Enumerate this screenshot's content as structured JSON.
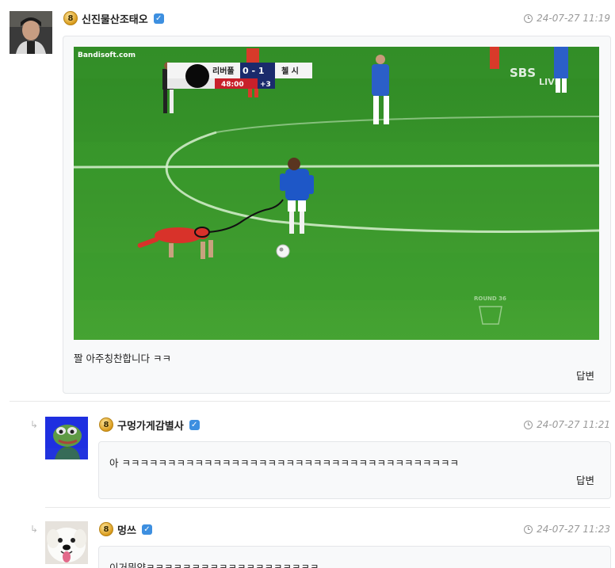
{
  "comments": [
    {
      "username": "신진물산조태오",
      "level": "8",
      "timestamp": "24-07-27 11:19",
      "text": "짤 아주칭찬합니다 ㅋㅋ",
      "reply_label": "답변",
      "media": {
        "watermark": "Bandisoft.com",
        "broadcaster": "SBS",
        "live": "LIVE",
        "score_team_home": "리버풀",
        "score": "0 - 1",
        "score_team_away": "첼 시",
        "match_clock": "48:00",
        "added_time": "+3",
        "round": "ROUND 36"
      }
    },
    {
      "username": "구멍가게감별사",
      "level": "8",
      "timestamp": "24-07-27 11:21",
      "text": "아 ㅋㅋㅋㅋㅋㅋㅋㅋㅋㅋㅋㅋㅋㅋㅋㅋㅋㅋㅋㅋㅋㅋㅋㅋㅋㅋㅋㅋㅋㅋㅋㅋㅋㅋㅋㅋㅋ",
      "reply_label": "답변"
    },
    {
      "username": "멍쓰",
      "level": "8",
      "timestamp": "24-07-27 11:23",
      "text": "이거뭐얌ㅋㅋㅋㅋㅋㅋㅋㅋㅋㅋㅋㅋㅋㅋㅋㅋㅋㅋㅋ"
    }
  ],
  "colors": {
    "pitch": "#3c9a2e",
    "verified": "#3d8fe0",
    "level_badge": "#d99a1a"
  }
}
